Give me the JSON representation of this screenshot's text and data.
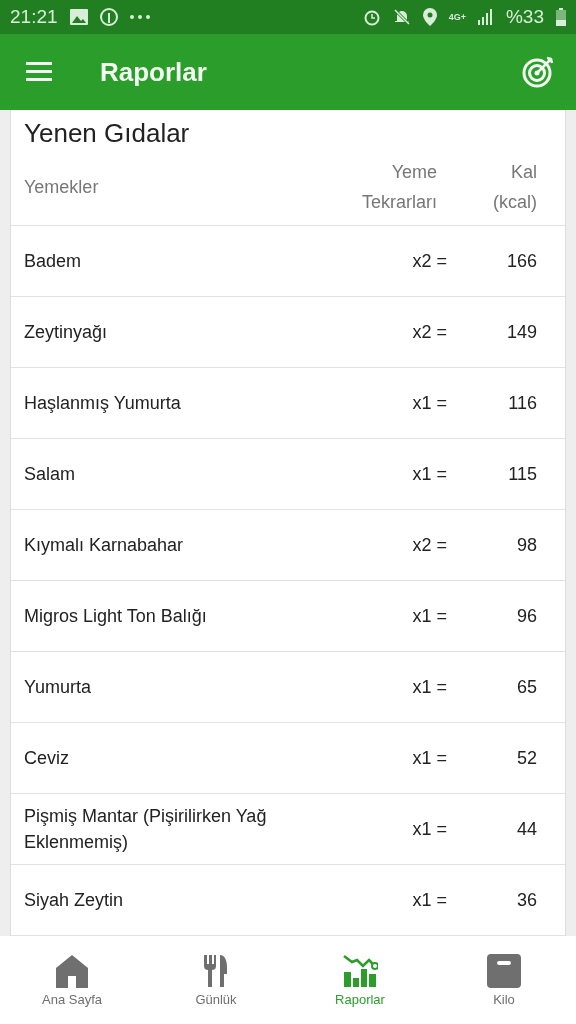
{
  "status_bar": {
    "time": "21:21",
    "network": "4G+",
    "battery": "%33"
  },
  "app_bar": {
    "title": "Raporlar"
  },
  "card": {
    "title": "Yenen Gıdalar",
    "columns": [
      {
        "label": "Yemekler"
      },
      {
        "label": "Yeme Tekrarları"
      },
      {
        "label": "Kal (kcal)"
      }
    ],
    "rows": [
      {
        "food": "Badem",
        "count": "x2 =",
        "kcal": "166"
      },
      {
        "food": "Zeytinyağı",
        "count": "x2 =",
        "kcal": "149"
      },
      {
        "food": "Haşlanmış Yumurta",
        "count": "x1 =",
        "kcal": "116"
      },
      {
        "food": "Salam",
        "count": "x1 =",
        "kcal": "115"
      },
      {
        "food": "Kıymalı Karnabahar",
        "count": "x2 =",
        "kcal": "98"
      },
      {
        "food": "Migros Light Ton Balığı",
        "count": "x1 =",
        "kcal": "96"
      },
      {
        "food": "Yumurta",
        "count": "x1 =",
        "kcal": "65"
      },
      {
        "food": "Ceviz",
        "count": "x1 =",
        "kcal": "52"
      },
      {
        "food": "Pişmiş Mantar (Pişirilirken Yağ Eklenmemiş)",
        "count": "x1 =",
        "kcal": "44"
      },
      {
        "food": "Siyah Zeytin",
        "count": "x1 =",
        "kcal": "36"
      }
    ]
  },
  "bottom_nav": [
    {
      "kind": "home",
      "label": "Ana Sayfa",
      "selected": false
    },
    {
      "kind": "diary",
      "label": "Günlük",
      "selected": false
    },
    {
      "kind": "reports",
      "label": "Raporlar",
      "selected": true
    },
    {
      "kind": "weight",
      "label": "Kilo",
      "selected": false
    }
  ]
}
